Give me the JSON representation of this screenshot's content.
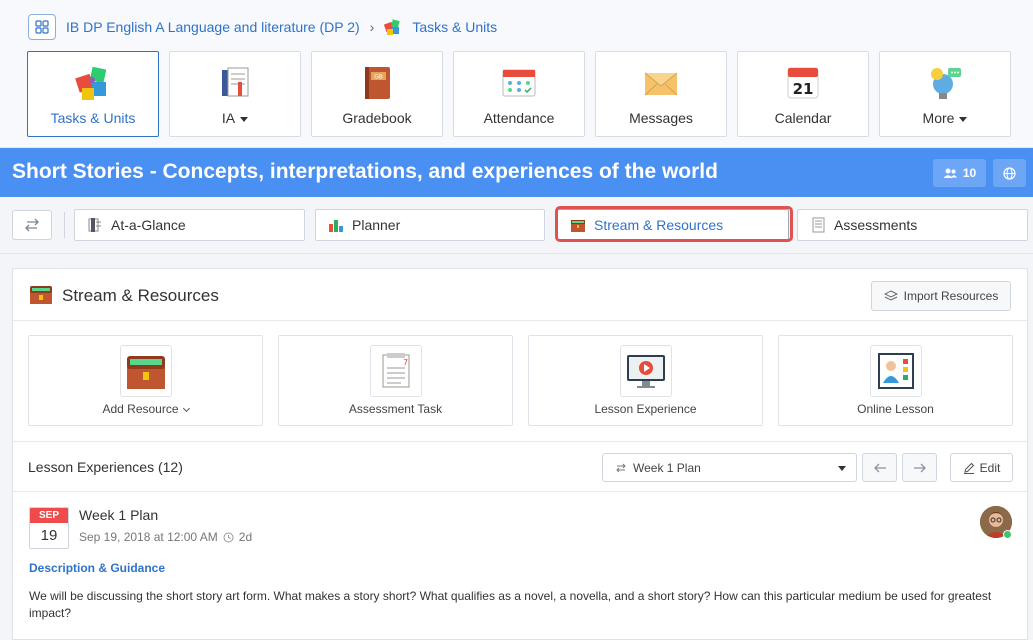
{
  "breadcrumb": {
    "course": "IB DP English A Language and literature (DP 2)",
    "separator": "›",
    "current": "Tasks & Units"
  },
  "nav_tiles": [
    {
      "label": "Tasks & Units",
      "icon": "puzzle-icon",
      "active": true
    },
    {
      "label": "IA",
      "icon": "ia-notebook-icon",
      "dropdown": true
    },
    {
      "label": "Gradebook",
      "icon": "gradebook-icon"
    },
    {
      "label": "Attendance",
      "icon": "attendance-icon"
    },
    {
      "label": "Messages",
      "icon": "envelope-icon"
    },
    {
      "label": "Calendar",
      "icon": "calendar-icon",
      "calendar_day": "21"
    },
    {
      "label": "More",
      "icon": "lightbulb-chat-icon",
      "dropdown": true
    }
  ],
  "banner": {
    "title": "Short Stories - Concepts, interpretations, and experiences of the world",
    "members_count": "10",
    "color": "#4a8ff2"
  },
  "tabs": [
    {
      "label": "At-a-Glance",
      "icon": "glance-icon"
    },
    {
      "label": "Planner",
      "icon": "bar-chart-icon"
    },
    {
      "label": "Stream & Resources",
      "icon": "chest-icon",
      "active": true
    },
    {
      "label": "Assessments",
      "icon": "assessments-icon"
    }
  ],
  "section": {
    "title": "Stream & Resources",
    "import_label": "Import Resources"
  },
  "resource_tiles": [
    {
      "label": "Add Resource",
      "icon": "chest-icon",
      "dropdown": true
    },
    {
      "label": "Assessment Task",
      "icon": "checklist-icon"
    },
    {
      "label": "Lesson Experience",
      "icon": "video-screen-icon"
    },
    {
      "label": "Online Lesson",
      "icon": "online-lesson-icon"
    }
  ],
  "lessons": {
    "title": "Lesson Experiences (12)",
    "week_selected": "Week 1 Plan",
    "edit_label": "Edit"
  },
  "entry": {
    "month": "SEP",
    "day": "19",
    "title": "Week 1 Plan",
    "datetime": "Sep 19, 2018 at 12:00 AM",
    "ago": "2d",
    "guidance_label": "Description & Guidance",
    "description": "We will be discussing the short story art form. What makes a story short? What qualifies as a novel, a novella, and a short story? How can this particular medium be used for greatest impact?"
  },
  "colors": {
    "accent": "#2f73c9",
    "highlight": "#e0524f",
    "date_red": "#ef4b4b",
    "online_green": "#3ec46d"
  }
}
